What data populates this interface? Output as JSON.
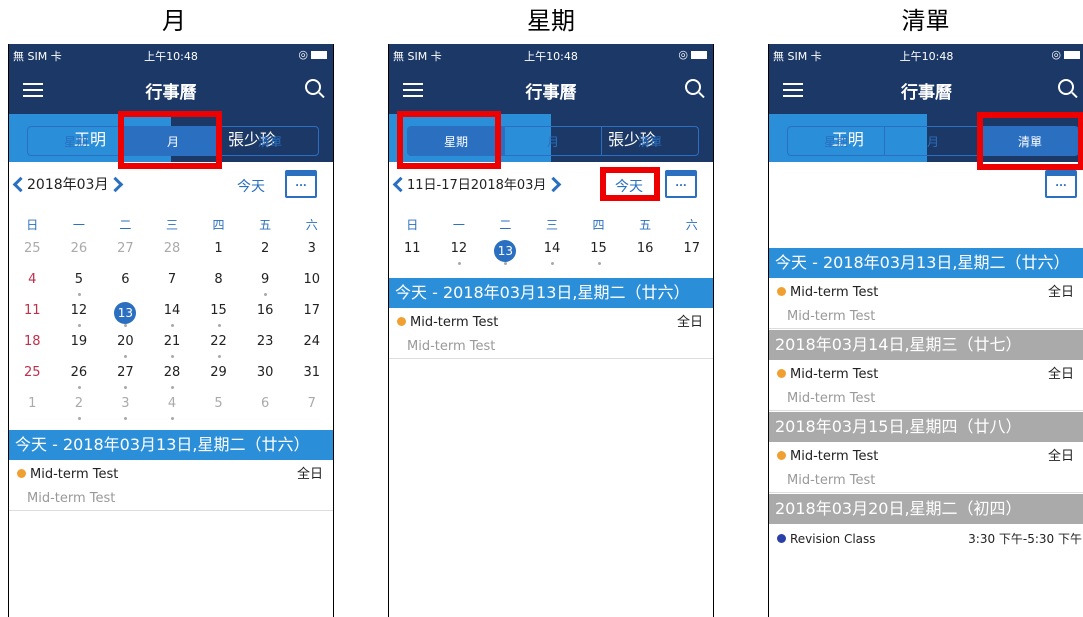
{
  "captions": [
    "月",
    "星期",
    "清單"
  ],
  "status": {
    "carrier": "無 SIM 卡",
    "time": "上午10:48",
    "alarm": "◎"
  },
  "nav": {
    "title": "行事曆"
  },
  "people": [
    "王明",
    "張少珍"
  ],
  "segments": [
    "星期",
    "月",
    "清單"
  ],
  "today_label": "今天",
  "cal_icon_text": "...",
  "month_title": "2018年03月",
  "week_range_title": "11日-17日2018年03月",
  "weekdays": [
    "日",
    "一",
    "二",
    "三",
    "四",
    "五",
    "六"
  ],
  "month_grid": [
    [
      "25",
      "26",
      "27",
      "28",
      "1",
      "2",
      "3"
    ],
    [
      "4",
      "5",
      "6",
      "7",
      "8",
      "9",
      "10"
    ],
    [
      "11",
      "12",
      "13",
      "14",
      "15",
      "16",
      "17"
    ],
    [
      "18",
      "19",
      "20",
      "21",
      "22",
      "23",
      "24"
    ],
    [
      "25",
      "26",
      "27",
      "28",
      "29",
      "30",
      "31"
    ],
    [
      "1",
      "2",
      "3",
      "4",
      "5",
      "6",
      "7"
    ]
  ],
  "week_row": [
    "11",
    "12",
    "13",
    "14",
    "15",
    "16",
    "17"
  ],
  "today_header": "今天 - 2018年03月13日,星期二（廿六）",
  "list_days": [
    {
      "header": "今天 - 2018年03月13日,星期二（廿六）",
      "event": "Mid-term Test",
      "time": "全日",
      "sub": "Mid-term Test"
    },
    {
      "header": "2018年03月14日,星期三（廿七）",
      "event": "Mid-term Test",
      "time": "全日",
      "sub": "Mid-term Test"
    },
    {
      "header": "2018年03月15日,星期四（廿八）",
      "event": "Mid-term Test",
      "time": "全日",
      "sub": "Mid-term Test"
    },
    {
      "header": "2018年03月20日,星期二（初四）",
      "event": "Revision Class",
      "time": "3:30 下午-5:30 下午",
      "sub": ""
    }
  ],
  "event": {
    "title": "Mid-term Test",
    "time": "全日",
    "sub": "Mid-term Test"
  },
  "colors": {
    "navbar": "#1b3867",
    "accent": "#2a8fd8",
    "highlight": "#ee0000"
  }
}
